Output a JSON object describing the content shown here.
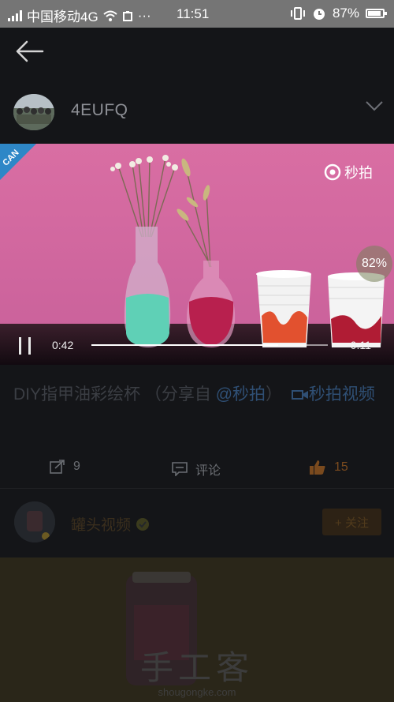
{
  "status_bar": {
    "carrier": "中国移动4G",
    "time": "11:51",
    "battery": "87%",
    "battery_level": 0.87
  },
  "header": {
    "back_icon": "arrow-left-icon"
  },
  "author": {
    "name": "4EUFQ",
    "expand_icon": "chevron-down-icon"
  },
  "video": {
    "brand": "秒拍",
    "corner_badge": "CAN",
    "load_percent": "82%",
    "elapsed": "0:42",
    "remaining": "-0:11",
    "played_fraction": 0.79
  },
  "post": {
    "title_text": "DIY指甲油彩绘杯 （分享自 ",
    "mention": "@秒拍",
    "after_mention": "）",
    "video_link": "秒拍视频"
  },
  "actions": {
    "repost_count": "9",
    "comment_label": "评论",
    "like_count": "15"
  },
  "next_card": {
    "name": "罐头视频",
    "follow_label": "+ 关注"
  },
  "watermark": {
    "cn": "手工客",
    "url": "shougongke.com"
  },
  "colors": {
    "background": "#141518",
    "status_bar": "#757575",
    "video_wall": "#d76fa1",
    "link": "#2f4f74",
    "like": "#7a4a1e"
  }
}
